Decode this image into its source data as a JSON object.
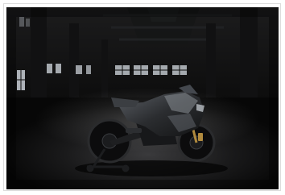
{
  "image": {
    "subject": "motorcycle-in-dark-warehouse",
    "colors": {
      "background": "#0a0a0a",
      "frame_border": "#dcdcdc",
      "window_glow": "#c9cfd6",
      "bike_body": "#2b2d30",
      "bike_highlight": "#8a8f96",
      "gold_accent": "#b08a3e"
    }
  }
}
